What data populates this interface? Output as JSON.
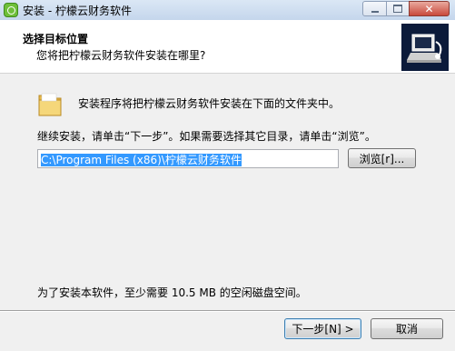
{
  "window": {
    "title": "安装 - 柠檬云财务软件",
    "icon": "app-icon",
    "controls": {
      "minimize": "minimize-icon",
      "maximize": "maximize-icon",
      "close": "close-icon"
    },
    "close_glyph": "✕"
  },
  "header": {
    "title": "选择目标位置",
    "subtitle": "您将把柠檬云财务软件安装在哪里?",
    "logo_icon": "installer-computer-icon"
  },
  "main": {
    "folder_icon": "folder-icon",
    "intro": "安装程序将把柠檬云财务软件安装在下面的文件夹中。",
    "instruction": "继续安装，请单击“下一步”。如果需要选择其它目录，请单击“浏览”。",
    "path_value": "C:\\Program Files (x86)\\柠檬云财务软件",
    "browse_label": "浏览[r]...",
    "space_text": "为了安装本软件，至少需要 10.5 MB 的空闲磁盘空间。"
  },
  "footer": {
    "next_label": "下一步[N] >",
    "cancel_label": "取消"
  },
  "colors": {
    "selection": "#3399ff",
    "close_button": "#c9493b",
    "header_bg": "#ffffff",
    "dialog_bg": "#f0f0f0"
  }
}
